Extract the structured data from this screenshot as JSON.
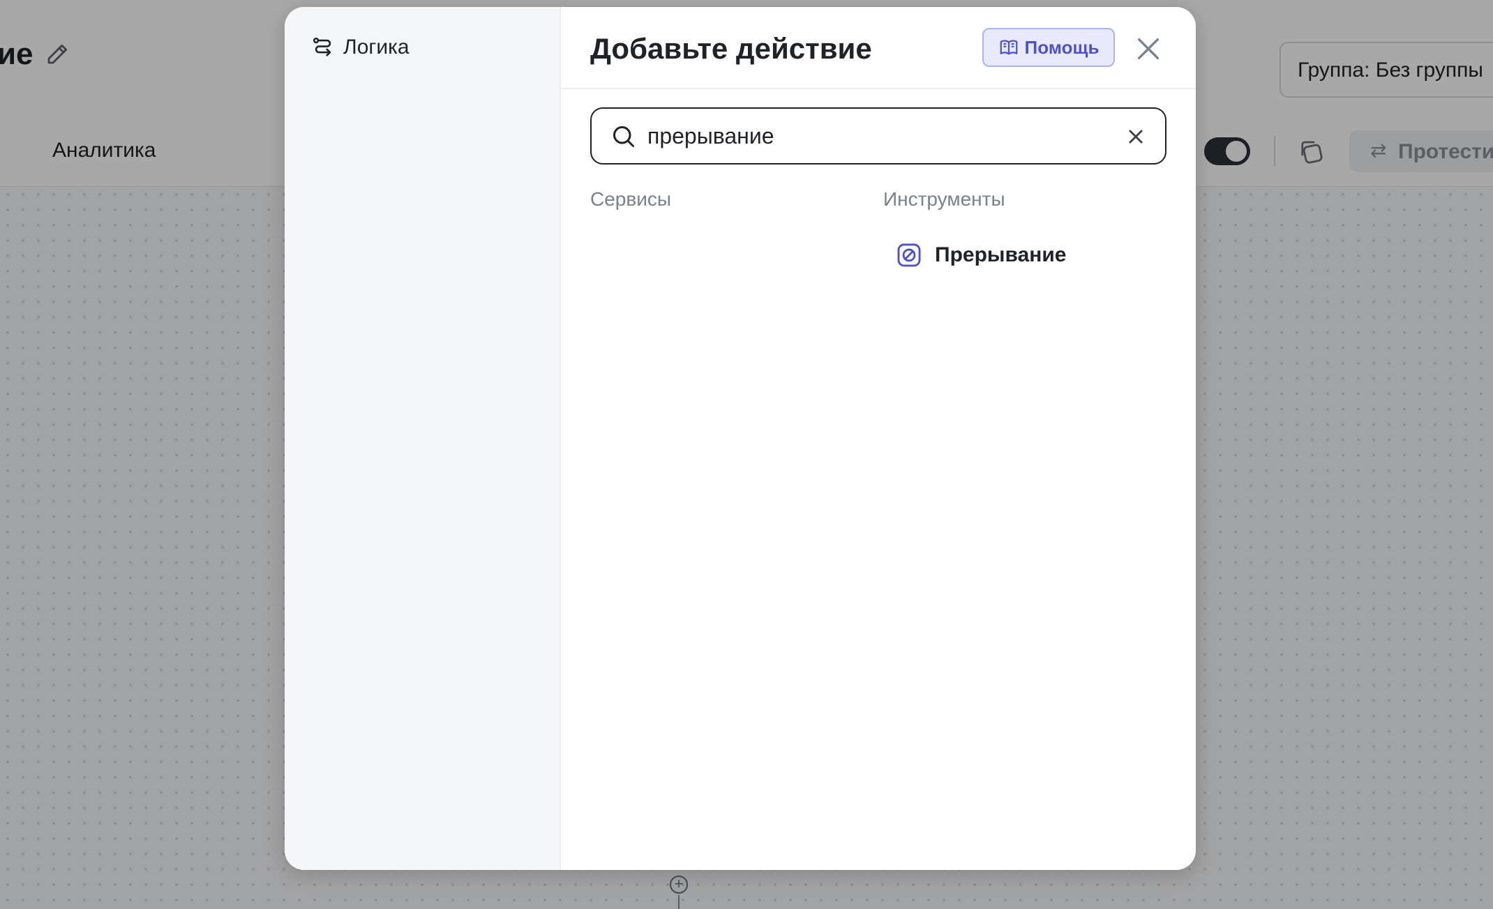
{
  "app": {
    "title": "ие",
    "group_select": "Группа: Без группы",
    "toolbar_tab": "Аналитика",
    "test_button": "Протестир",
    "test_icon": "⇄"
  },
  "modal": {
    "title": "Добавьте действие",
    "help_label": "Помощь",
    "sidebar": {
      "items": [
        {
          "label": "Логика",
          "icon": "logic-branch-icon"
        }
      ]
    },
    "search": {
      "value": "прерывание",
      "placeholder": ""
    },
    "columns": {
      "services": "Сервисы",
      "tools": "Инструменты"
    },
    "results": {
      "tools": [
        {
          "label": "Прерывание",
          "icon": "stop-icon"
        }
      ]
    }
  },
  "colors": {
    "accent": "#5050c8",
    "accent_bg": "#e8e9fb",
    "text": "#1f2328",
    "muted": "#7a818c"
  }
}
